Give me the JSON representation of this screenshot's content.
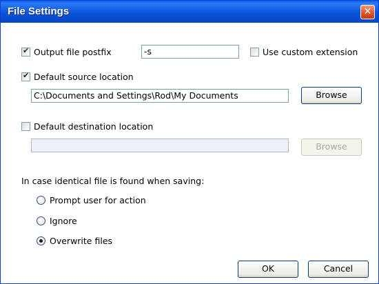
{
  "window": {
    "title": "File Settings",
    "close_glyph": "✕"
  },
  "output_postfix": {
    "label": "Output file postfix",
    "checked": true,
    "value": "-s"
  },
  "custom_extension": {
    "label": "Use custom extension",
    "checked": false
  },
  "source_location": {
    "label": "Default source location",
    "checked": true,
    "path": "C:\\Documents and Settings\\Rod\\My Documents",
    "browse_label": "Browse"
  },
  "destination_location": {
    "label": "Default destination location",
    "checked": false,
    "path": "",
    "browse_label": "Browse"
  },
  "identical_file": {
    "prompt": "In case identical file is found when saving:",
    "options": [
      {
        "label": "Prompt user for action",
        "selected": false
      },
      {
        "label": "Ignore",
        "selected": false
      },
      {
        "label": "Overwrite files",
        "selected": true
      }
    ]
  },
  "buttons": {
    "ok": "OK",
    "cancel": "Cancel"
  }
}
